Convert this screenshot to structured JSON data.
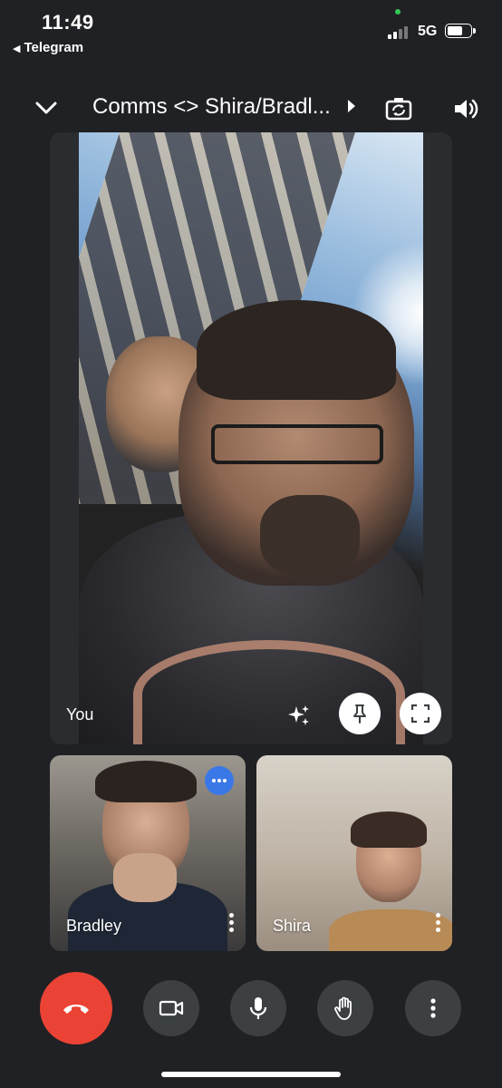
{
  "status_bar": {
    "time": "11:49",
    "back_app": "Telegram",
    "network": "5G",
    "signal_bars_active": 2,
    "battery_level": 0.7
  },
  "call": {
    "title": "Comms <> Shira/Bradl..."
  },
  "tiles": {
    "self_label": "You",
    "participants": [
      {
        "name": "Bradley"
      },
      {
        "name": "Shira"
      }
    ]
  },
  "icons": {
    "collapse": "chevron-down-icon",
    "switch_camera": "switch-camera-icon",
    "speaker": "speaker-icon",
    "effects": "sparkle-icon",
    "pin": "pin-icon",
    "fullscreen": "fullscreen-icon",
    "end_call": "end-call-icon",
    "camera": "video-camera-icon",
    "mic": "microphone-icon",
    "raise_hand": "raise-hand-icon",
    "more": "more-vertical-icon"
  },
  "colors": {
    "background": "#202124",
    "end_call": "#ea4335",
    "control_bg": "#3c4043",
    "badge": "#3b78e7",
    "status_dot": "#34c759"
  }
}
